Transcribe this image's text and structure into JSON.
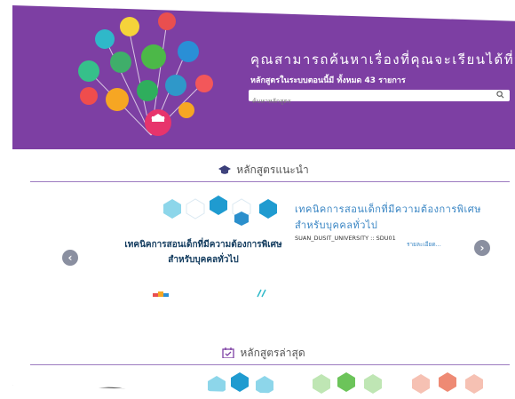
{
  "hero": {
    "title": "คุณสามารถค้นหาเรื่องที่คุณจะเรียนได้ที่นี่...",
    "subtitle": "หลักสูตรในระบบตอนนี้มี ทั้งหมด 43 รายการ",
    "search_placeholder": "ค้นหาหลักสูตร",
    "brand_color": "#7d3fa3"
  },
  "recommended": {
    "heading": "หลักสูตรแนะนำ",
    "card_image_text_line1": "เทคนิคการสอนเด็กที่มีความต้องการพิเศษ",
    "card_image_text_line2": "สำหรับบุคคลทั่วไป",
    "course_title": "เทคนิคการสอนเด็กที่มีความต้องการพิเศษ สำหรับบุคคลทั่วไป",
    "course_org": "SUAN_DUSIT_UNIVERSITY :: SDU01",
    "more_link": "รายละเอียด...",
    "prev_icon": "chevron-left-icon",
    "next_icon": "chevron-right-icon"
  },
  "latest": {
    "heading": "หลักสูตรล่าสุด"
  }
}
